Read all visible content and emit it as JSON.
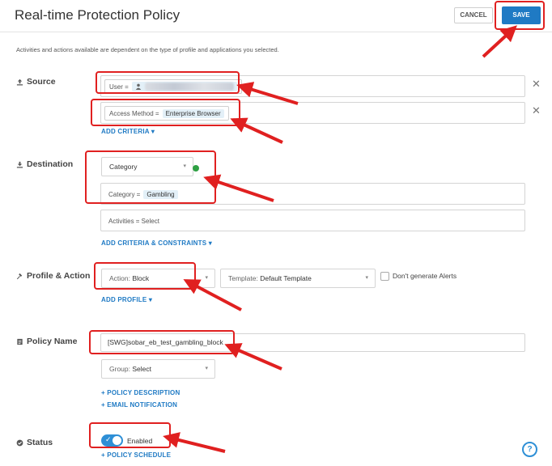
{
  "header": {
    "title": "Real-time Protection Policy",
    "cancel_label": "CANCEL",
    "save_label": "SAVE"
  },
  "note": "Activities and actions available are dependent on the type of profile and applications you selected.",
  "source": {
    "label": "Source",
    "user_key": "User =",
    "access_method_key": "Access Method =",
    "access_method_value": "Enterprise Browser",
    "add_criteria": "ADD CRITERIA"
  },
  "destination": {
    "label": "Destination",
    "type_select": "Category",
    "category_key": "Category =",
    "category_value": "Gambling",
    "activities": "Activities = Select",
    "add_criteria_constraints": "ADD CRITERIA & CONSTRAINTS"
  },
  "profile_action": {
    "label": "Profile & Action",
    "action_key": "Action:",
    "action_value": "Block",
    "template_key": "Template:",
    "template_value": "Default Template",
    "dont_generate_alerts": "Don't generate Alerts",
    "add_profile": "ADD PROFILE"
  },
  "policy_name": {
    "label": "Policy Name",
    "value": "[SWG]sobar_eb_test_gambling_block",
    "group_key": "Group:",
    "group_value": "Select",
    "policy_description": "+ POLICY DESCRIPTION",
    "email_notification": "+ EMAIL NOTIFICATION"
  },
  "status": {
    "label": "Status",
    "toggle_label": "Enabled",
    "policy_schedule": "+ POLICY SCHEDULE"
  },
  "help_icon": "?",
  "colors": {
    "accent": "#1f7ac4",
    "annotation": "#e02020",
    "status_dot": "#2ea043"
  }
}
